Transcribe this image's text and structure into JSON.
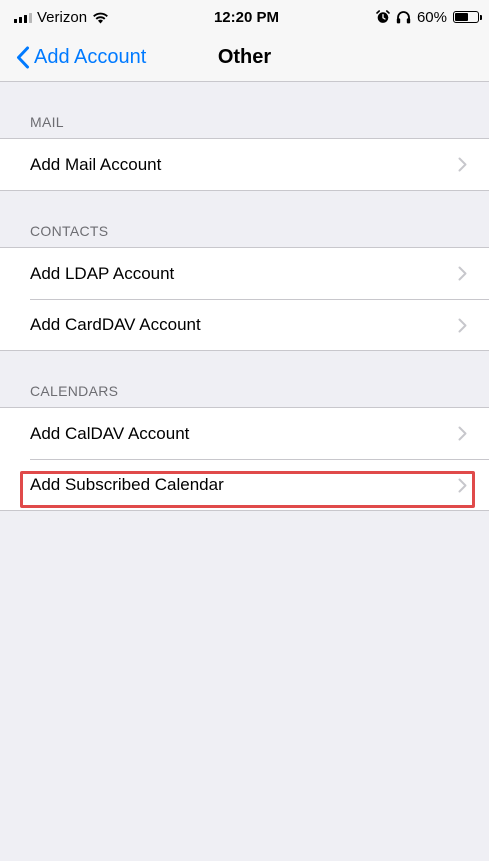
{
  "status_bar": {
    "carrier": "Verizon",
    "time": "12:20 PM",
    "battery_percent": "60%",
    "battery_level": 0.6,
    "icons": [
      "signal-icon",
      "wifi-icon",
      "alarm-icon",
      "headphones-icon",
      "battery-icon"
    ]
  },
  "nav": {
    "back_label": "Add Account",
    "title": "Other"
  },
  "sections": [
    {
      "header": "MAIL",
      "rows": [
        "Add Mail Account"
      ]
    },
    {
      "header": "CONTACTS",
      "rows": [
        "Add LDAP Account",
        "Add CardDAV Account"
      ]
    },
    {
      "header": "CALENDARS",
      "rows": [
        "Add CalDAV Account",
        "Add Subscribed Calendar"
      ]
    }
  ],
  "colors": {
    "accent": "#007aff",
    "background": "#efeff4",
    "highlight": "#e04a4a"
  }
}
